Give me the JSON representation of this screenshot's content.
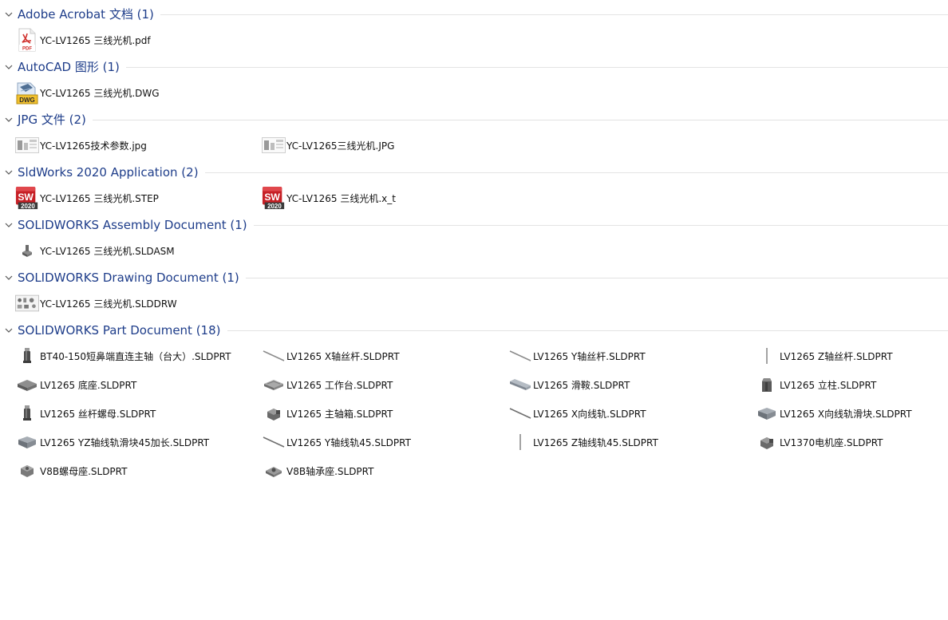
{
  "groups": [
    {
      "title": "Adobe Acrobat 文档 (1)",
      "items": [
        {
          "label": "YC-LV1265 三线光机.pdf",
          "icon": "pdf-icon"
        }
      ]
    },
    {
      "title": "AutoCAD 图形 (1)",
      "items": [
        {
          "label": "YC-LV1265 三线光机.DWG",
          "icon": "dwg-icon"
        }
      ]
    },
    {
      "title": "JPG 文件 (2)",
      "items": [
        {
          "label": "YC-LV1265技术参数.jpg",
          "icon": "image-thumbnail-icon"
        },
        {
          "label": "YC-LV1265三线光机.JPG",
          "icon": "image-thumbnail-icon"
        }
      ]
    },
    {
      "title": "SldWorks 2020 Application (2)",
      "items": [
        {
          "label": "YC-LV1265 三线光机.STEP",
          "icon": "solidworks-2020-icon"
        },
        {
          "label": "YC-LV1265 三线光机.x_t",
          "icon": "solidworks-2020-icon"
        }
      ]
    },
    {
      "title": "SOLIDWORKS Assembly Document (1)",
      "items": [
        {
          "label": "YC-LV1265 三线光机.SLDASM",
          "icon": "assembly-thumbnail-icon"
        }
      ]
    },
    {
      "title": "SOLIDWORKS Drawing Document (1)",
      "items": [
        {
          "label": "YC-LV1265 三线光机.SLDDRW",
          "icon": "drawing-thumbnail-icon"
        }
      ]
    },
    {
      "title": "SOLIDWORKS Part Document (18)",
      "items": [
        {
          "label": "BT40-150短鼻端直连主轴（台大）.SLDPRT",
          "icon": "spindle-part-icon"
        },
        {
          "label": "LV1265   X轴丝杆.SLDPRT",
          "icon": "screw-diagonal-part-icon"
        },
        {
          "label": "LV1265   Y轴丝杆.SLDPRT",
          "icon": "screw-diagonal-part-icon"
        },
        {
          "label": "LV1265   Z轴丝杆.SLDPRT",
          "icon": "screw-vertical-part-icon"
        },
        {
          "label": "LV1265   底座.SLDPRT",
          "icon": "block-part-icon"
        },
        {
          "label": "LV1265   工作台.SLDPRT",
          "icon": "table-part-icon"
        },
        {
          "label": "LV1265   滑鞍.SLDPRT",
          "icon": "saddle-part-icon"
        },
        {
          "label": "LV1265   立柱.SLDPRT",
          "icon": "column-part-icon"
        },
        {
          "label": "LV1265   丝杆螺母.SLDPRT",
          "icon": "spindle-part-icon"
        },
        {
          "label": "LV1265   主轴箱.SLDPRT",
          "icon": "headstock-part-icon"
        },
        {
          "label": "LV1265 X向线轨.SLDPRT",
          "icon": "rail-diagonal-part-icon"
        },
        {
          "label": "LV1265 X向线轨滑块.SLDPRT",
          "icon": "slider-block-part-icon"
        },
        {
          "label": "LV1265 YZ轴线轨滑块45加长.SLDPRT",
          "icon": "slider-block-part-icon"
        },
        {
          "label": "LV1265 Y轴线轨45.SLDPRT",
          "icon": "rail-diagonal-part-icon"
        },
        {
          "label": "LV1265 Z轴线轨45.SLDPRT",
          "icon": "screw-vertical-part-icon"
        },
        {
          "label": "LV1370电机座.SLDPRT",
          "icon": "headstock-part-icon"
        },
        {
          "label": "V8B螺母座.SLDPRT",
          "icon": "nut-seat-part-icon"
        },
        {
          "label": "V8B轴承座.SLDPRT",
          "icon": "bearing-seat-part-icon"
        }
      ]
    }
  ]
}
